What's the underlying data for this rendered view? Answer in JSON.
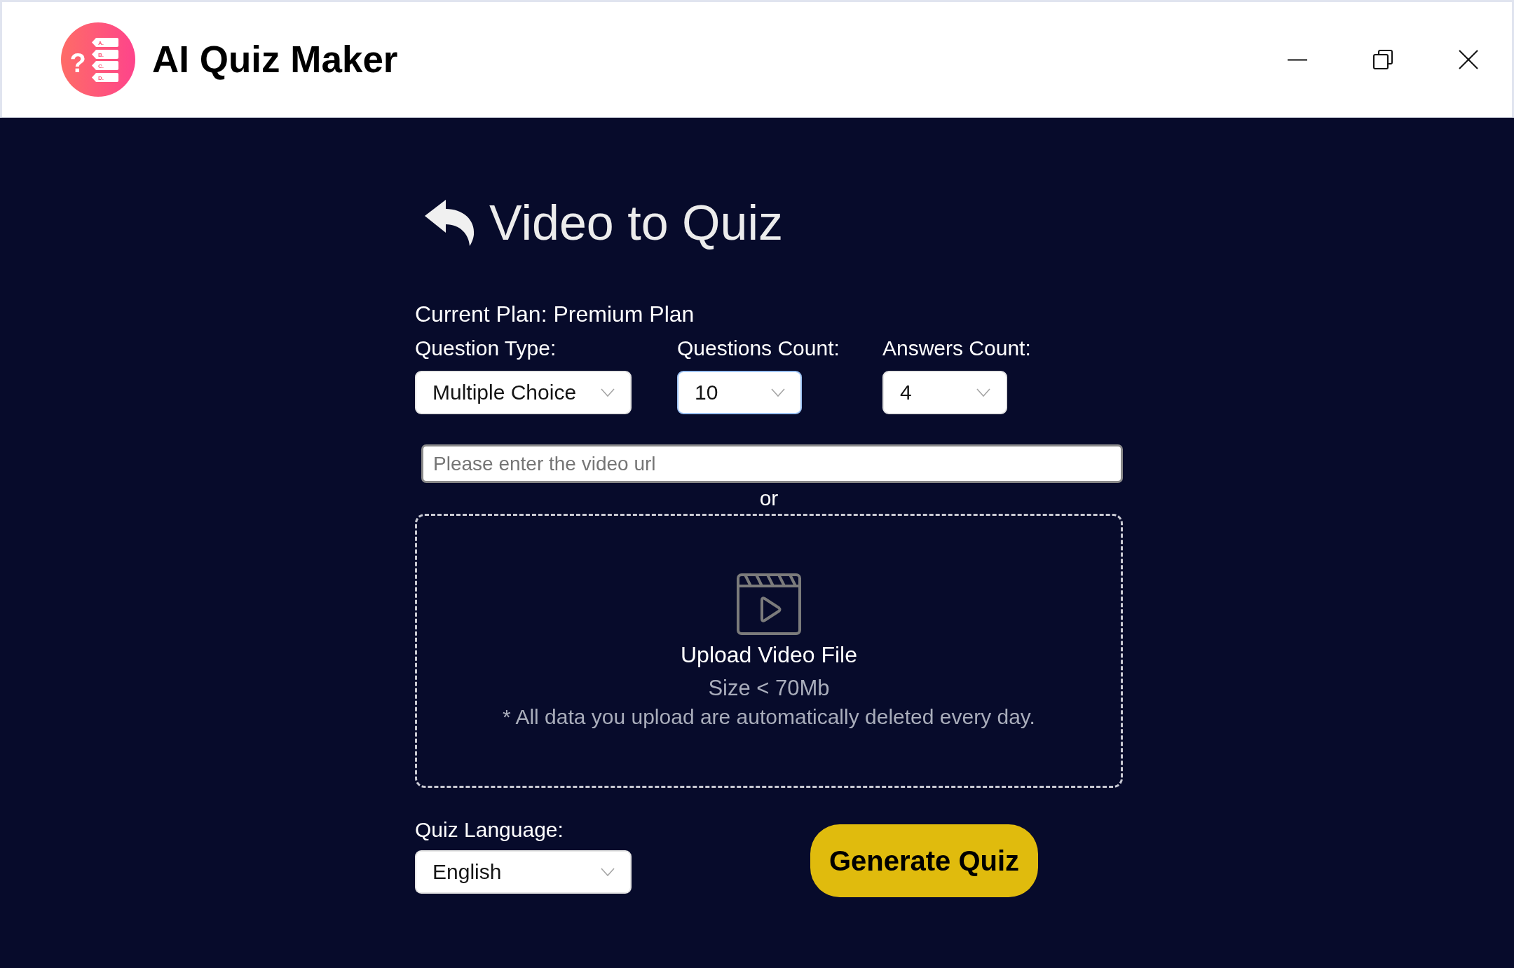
{
  "window": {
    "title": "AI Quiz Maker",
    "logo": {
      "symbol": "?",
      "options": [
        "A.",
        "B.",
        "C.",
        "D."
      ]
    }
  },
  "page": {
    "title": "Video to Quiz",
    "plan": "Current Plan: Premium Plan"
  },
  "settings": [
    {
      "label": "Question Type:",
      "value": "Multiple Choice",
      "focused": false
    },
    {
      "label": "Questions Count:",
      "value": "10",
      "focused": true
    },
    {
      "label": "Answers Count:",
      "value": "4",
      "focused": false
    }
  ],
  "url_field": {
    "placeholder": "Please enter the video url"
  },
  "separator": "or",
  "upload": {
    "title": "Upload Video File",
    "size_limit": "Size < 70Mb",
    "note": "* All data you upload are automatically deleted every day."
  },
  "language": {
    "label": "Quiz Language:",
    "value": "English",
    "focused": false
  },
  "generate_button": "Generate Quiz"
}
